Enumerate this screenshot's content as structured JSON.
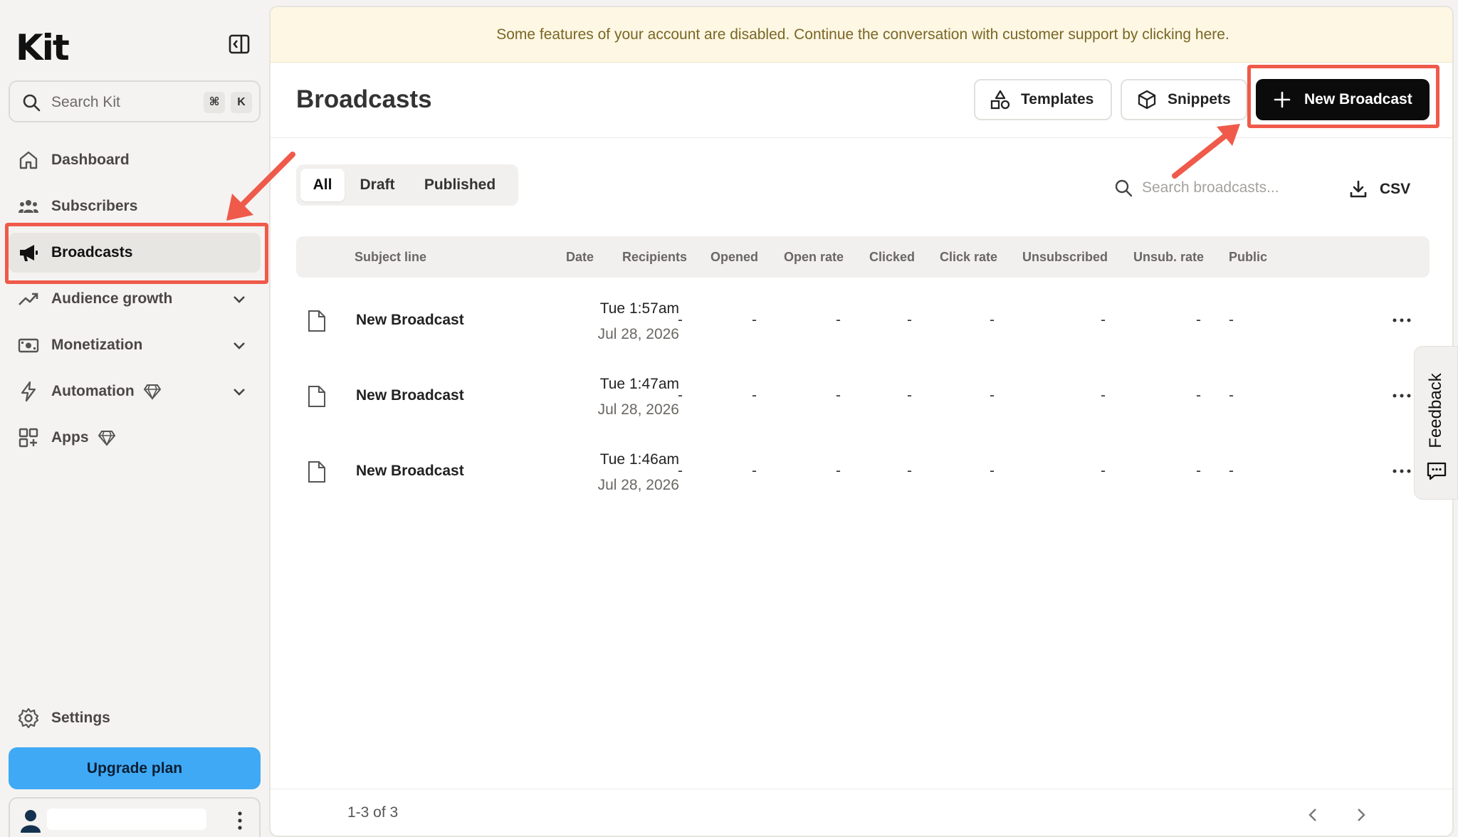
{
  "app": {
    "logo_text": "Kit",
    "accent_color": "#3fa9f5",
    "annotation_color": "#ef5a4a"
  },
  "sidebar": {
    "search": {
      "placeholder": "Search Kit",
      "shortcut_keys": [
        "⌘",
        "K"
      ]
    },
    "items": [
      {
        "label": "Dashboard",
        "icon": "home-icon"
      },
      {
        "label": "Subscribers",
        "icon": "users-icon"
      },
      {
        "label": "Broadcasts",
        "icon": "megaphone-icon",
        "active": true
      },
      {
        "label": "Audience growth",
        "icon": "trend-up-icon",
        "expandable": true
      },
      {
        "label": "Monetization",
        "icon": "money-icon",
        "expandable": true
      },
      {
        "label": "Automation",
        "icon": "bolt-icon",
        "expandable": true,
        "premium": true
      },
      {
        "label": "Apps",
        "icon": "apps-icon",
        "premium": true
      }
    ],
    "settings_label": "Settings",
    "upgrade_label": "Upgrade plan"
  },
  "banner": {
    "text": "Some features of your account are disabled. Continue the conversation with customer support by clicking here."
  },
  "header": {
    "title": "Broadcasts",
    "templates_label": "Templates",
    "snippets_label": "Snippets",
    "new_broadcast_label": "New Broadcast"
  },
  "filters": {
    "tabs": [
      "All",
      "Draft",
      "Published"
    ],
    "active_tab": "All",
    "search_placeholder": "Search broadcasts...",
    "csv_label": "CSV"
  },
  "table": {
    "columns": [
      "Subject line",
      "Date",
      "Recipients",
      "Opened",
      "Open rate",
      "Clicked",
      "Click rate",
      "Unsubscribed",
      "Unsub. rate",
      "Public"
    ],
    "rows": [
      {
        "subject": "New Broadcast",
        "time": "Tue 1:57am",
        "date": "Jul 28, 2026",
        "recipients": "-",
        "opened": "-",
        "open_rate": "-",
        "clicked": "-",
        "click_rate": "-",
        "unsubscribed": "-",
        "unsub_rate": "-",
        "public": "-"
      },
      {
        "subject": "New Broadcast",
        "time": "Tue 1:47am",
        "date": "Jul 28, 2026",
        "recipients": "-",
        "opened": "-",
        "open_rate": "-",
        "clicked": "-",
        "click_rate": "-",
        "unsubscribed": "-",
        "unsub_rate": "-",
        "public": "-"
      },
      {
        "subject": "New Broadcast",
        "time": "Tue 1:46am",
        "date": "Jul 28, 2026",
        "recipients": "-",
        "opened": "-",
        "open_rate": "-",
        "clicked": "-",
        "click_rate": "-",
        "unsubscribed": "-",
        "unsub_rate": "-",
        "public": "-"
      }
    ]
  },
  "pagination": {
    "text": "1-3 of 3"
  },
  "feedback": {
    "label": "Feedback"
  }
}
